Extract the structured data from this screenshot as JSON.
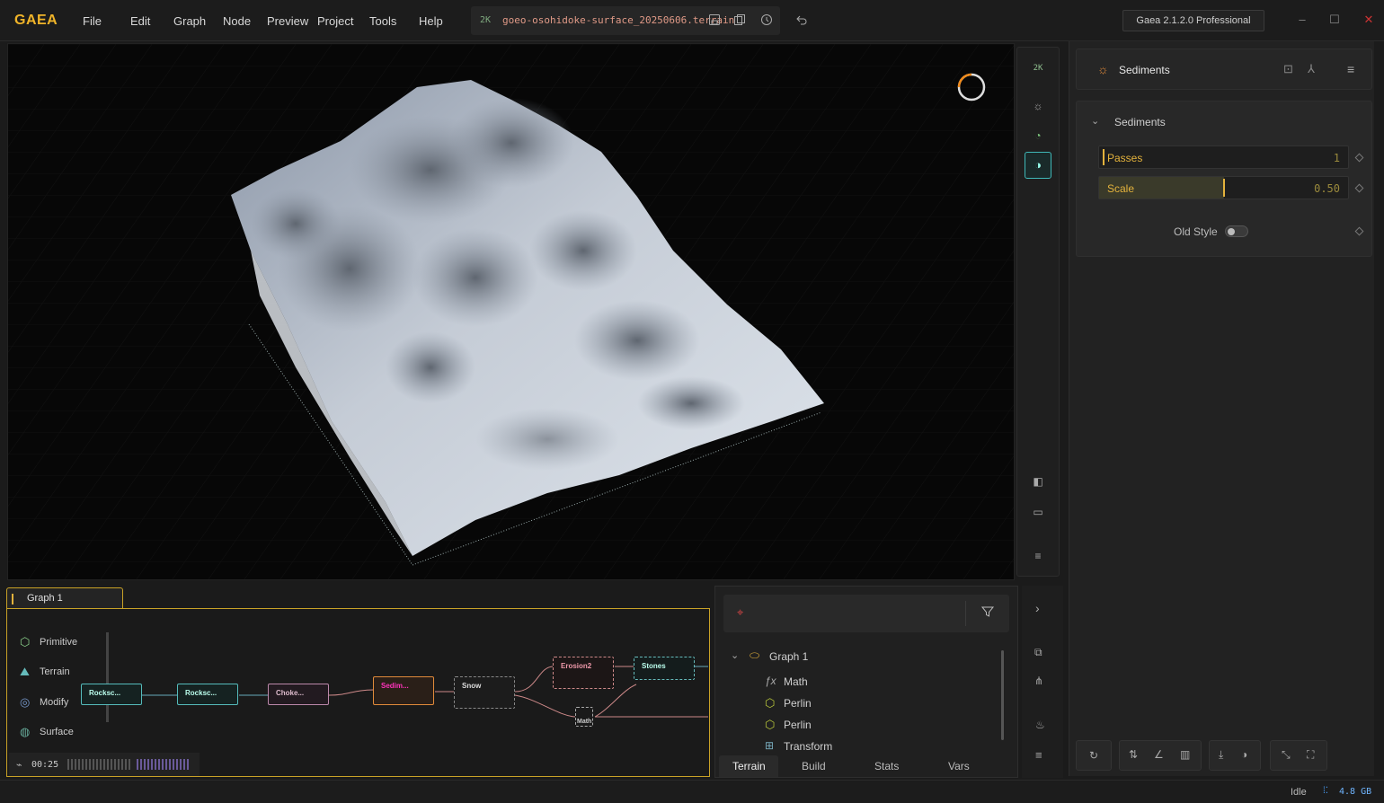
{
  "app": {
    "logo": "GAEA",
    "menu": [
      "File",
      "Edit",
      "Graph",
      "Node",
      "Preview",
      "Project",
      "Tools",
      "Help"
    ],
    "file_badge": "2K",
    "file_name": "goeo-osohidoke-surface_20250606.terrain",
    "version": "Gaea 2.1.2.0 Professional"
  },
  "viewport": {
    "resolution_badge": "2K"
  },
  "properties": {
    "node_name": "Sediments",
    "section_title": "Sediments",
    "params": [
      {
        "label": "Passes",
        "value": "1",
        "fill": 0.0
      },
      {
        "label": "Scale",
        "value": "0.50",
        "fill": 0.5
      }
    ],
    "toggle_label": "Old Style",
    "toggle_on": false
  },
  "graph": {
    "tab_label": "Graph 1",
    "palette": [
      "Primitive",
      "Terrain",
      "Modify",
      "Surface"
    ],
    "nodes": [
      "Rocksc...",
      "Rocksc...",
      "Choke...",
      "Sedim...",
      "Snow",
      "Erosion2",
      "Stones",
      "Math"
    ],
    "time": "00:25"
  },
  "explorer": {
    "root": "Graph 1",
    "items": [
      {
        "icon": "fx-icon",
        "label": "Math"
      },
      {
        "icon": "hexagon-icon",
        "label": "Perlin"
      },
      {
        "icon": "hexagon-icon",
        "label": "Perlin"
      },
      {
        "icon": "transform-icon",
        "label": "Transform"
      }
    ],
    "tabs": [
      "Terrain",
      "Build",
      "Stats",
      "Vars"
    ]
  },
  "status": {
    "state": "Idle",
    "memory": "4.8 GB"
  },
  "colors": {
    "accent": "#f0b429",
    "teal": "#3fb8b8",
    "file": "#e09a87"
  }
}
